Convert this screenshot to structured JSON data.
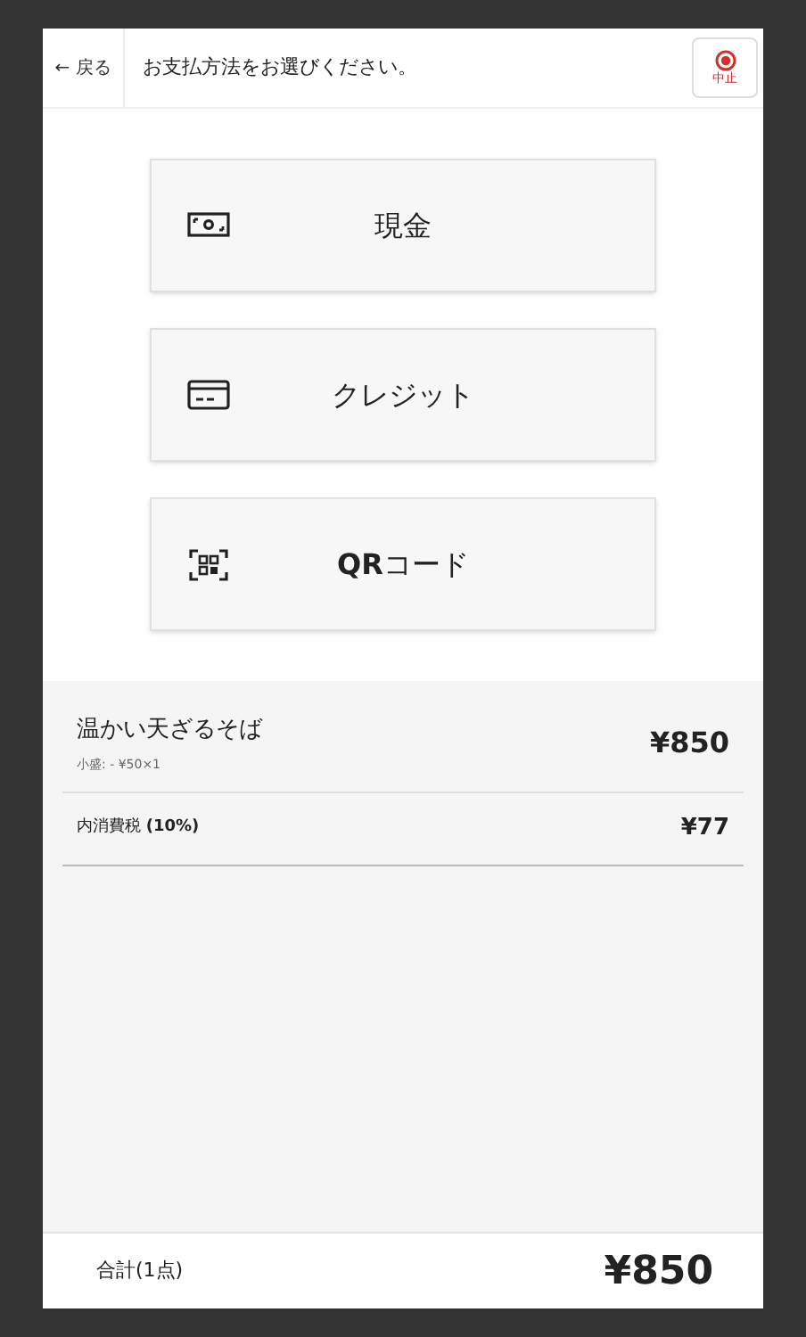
{
  "header": {
    "back": "← 戻る",
    "title": "お支払方法をお選びください。",
    "cancel": "中止"
  },
  "methods": [
    {
      "kind": "cash",
      "label": "現金"
    },
    {
      "kind": "card",
      "label": "クレジット"
    },
    {
      "kind": "qr",
      "label": "**QR**コード"
    }
  ],
  "items": [
    {
      "name": "温かい天ざるそば",
      "option": "小盛: - ¥50×1",
      "price": "¥850"
    }
  ],
  "tax": {
    "label": "内消費税 **(10%)**",
    "amount": "¥77"
  },
  "total": {
    "label": "合計(1点)",
    "amount": "¥850"
  }
}
